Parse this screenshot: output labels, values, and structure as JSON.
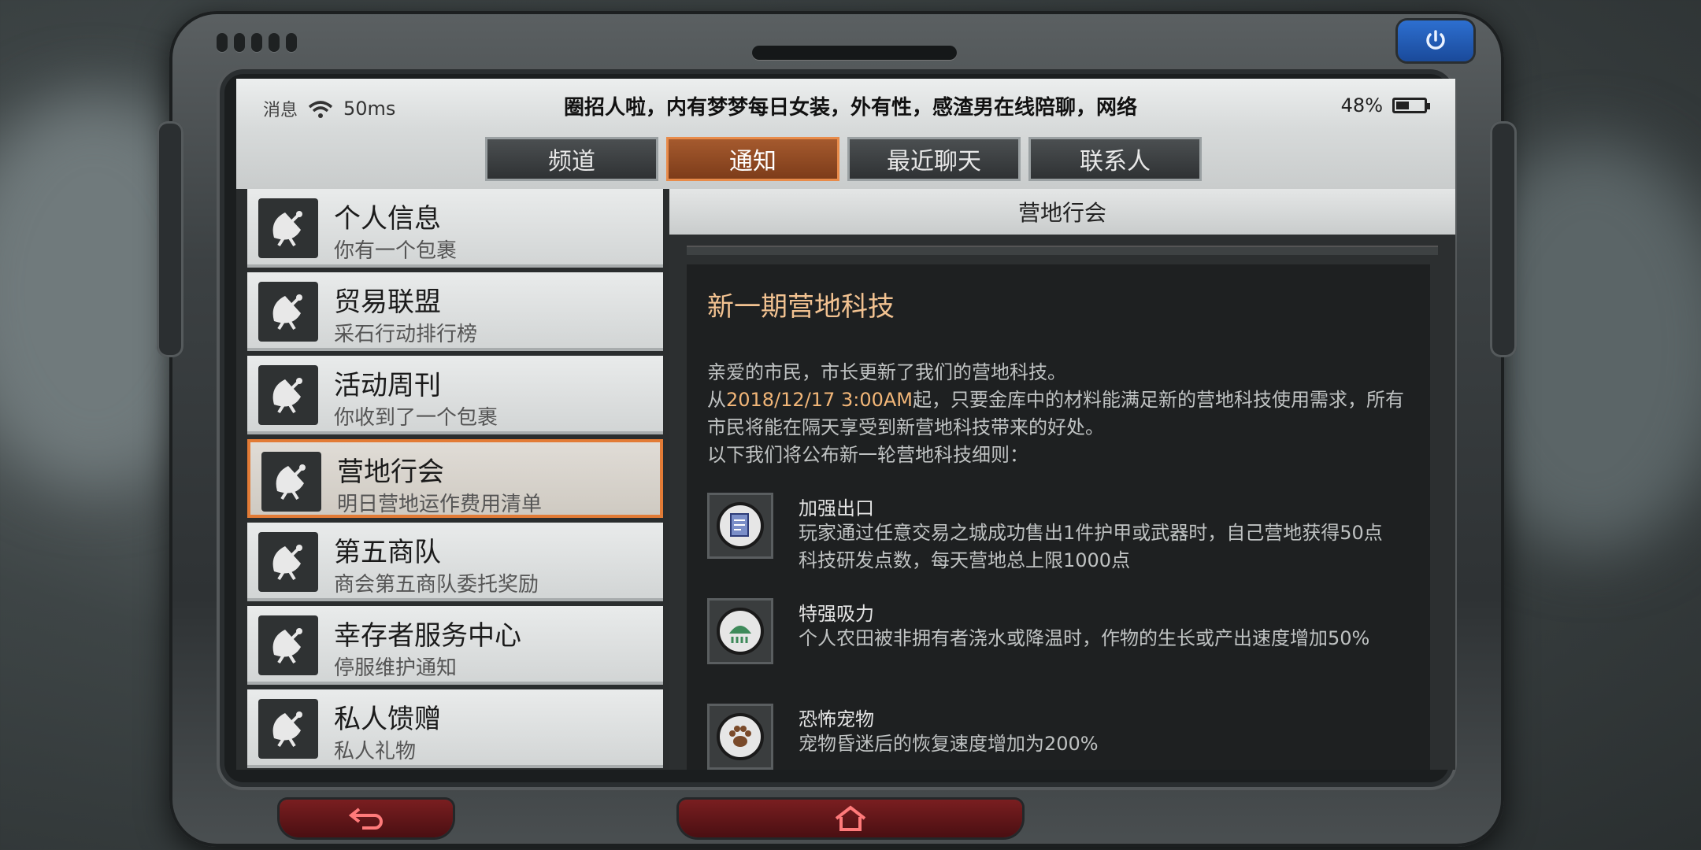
{
  "status_bar": {
    "messages_label": "消息",
    "ping": "50ms",
    "ticker": "圈招人啦，内有梦梦每日女装，外有性，感渣男在线陪聊，网络",
    "battery": "48%",
    "battery_level": 0.48
  },
  "tabs": [
    {
      "label": "频道",
      "active": false
    },
    {
      "label": "通知",
      "active": true
    },
    {
      "label": "最近聊天",
      "active": false
    },
    {
      "label": "联系人",
      "active": false
    }
  ],
  "notification_list": [
    {
      "title": "个人信息",
      "subtitle": "你有一个包裹",
      "icon": "satellite-dish-icon",
      "selected": false
    },
    {
      "title": "贸易联盟",
      "subtitle": "采石行动排行榜",
      "icon": "satellite-dish-icon",
      "selected": false
    },
    {
      "title": "活动周刊",
      "subtitle": "你收到了一个包裹",
      "icon": "satellite-dish-icon",
      "selected": false
    },
    {
      "title": "营地行会",
      "subtitle": "明日营地运作费用清单",
      "icon": "satellite-dish-icon",
      "selected": true
    },
    {
      "title": "第五商队",
      "subtitle": "商会第五商队委托奖励",
      "icon": "satellite-dish-icon",
      "selected": false
    },
    {
      "title": "幸存者服务中心",
      "subtitle": "停服维护通知",
      "icon": "satellite-dish-icon",
      "selected": false
    },
    {
      "title": "私人馈赠",
      "subtitle": "私人礼物",
      "icon": "satellite-dish-icon",
      "selected": false
    }
  ],
  "detail": {
    "header": "营地行会",
    "title": "新一期营地科技",
    "body_line1": "亲爱的市民，市长更新了我们的营地科技。",
    "body_from": "从",
    "body_date": "2018/12/17 3:00AM",
    "body_rest": "起，只要金库中的材料能满足新的营地科技使用需求，所有市民将能在隔天享受到新营地科技带来的好处。",
    "body_line4": "以下我们将公布新一轮营地科技细则：",
    "perks": [
      {
        "title": "加强出口",
        "desc": "玩家通过任意交易之城成功售出1件护甲或武器时，自己营地获得50点科技研发点数，每天营地总上限1000点",
        "icon": "document-icon"
      },
      {
        "title": "特强吸力",
        "desc": "个人农田被非拥有者浇水或降温时，作物的生长或产出速度增加50%",
        "icon": "leaf-icon"
      },
      {
        "title": "恐怖宠物",
        "desc": "宠物昏迷后的恢复速度增加为200%",
        "icon": "paw-icon"
      }
    ]
  },
  "device": {
    "power_icon": "power-icon",
    "back_icon": "back-arrow-icon",
    "home_icon": "home-icon"
  },
  "colors": {
    "accent_orange": "#e27b36",
    "date_highlight": "#f2b678",
    "title_color": "#f2c291",
    "power_blue": "#2d6fd0",
    "nav_red": "#7a1e20"
  }
}
